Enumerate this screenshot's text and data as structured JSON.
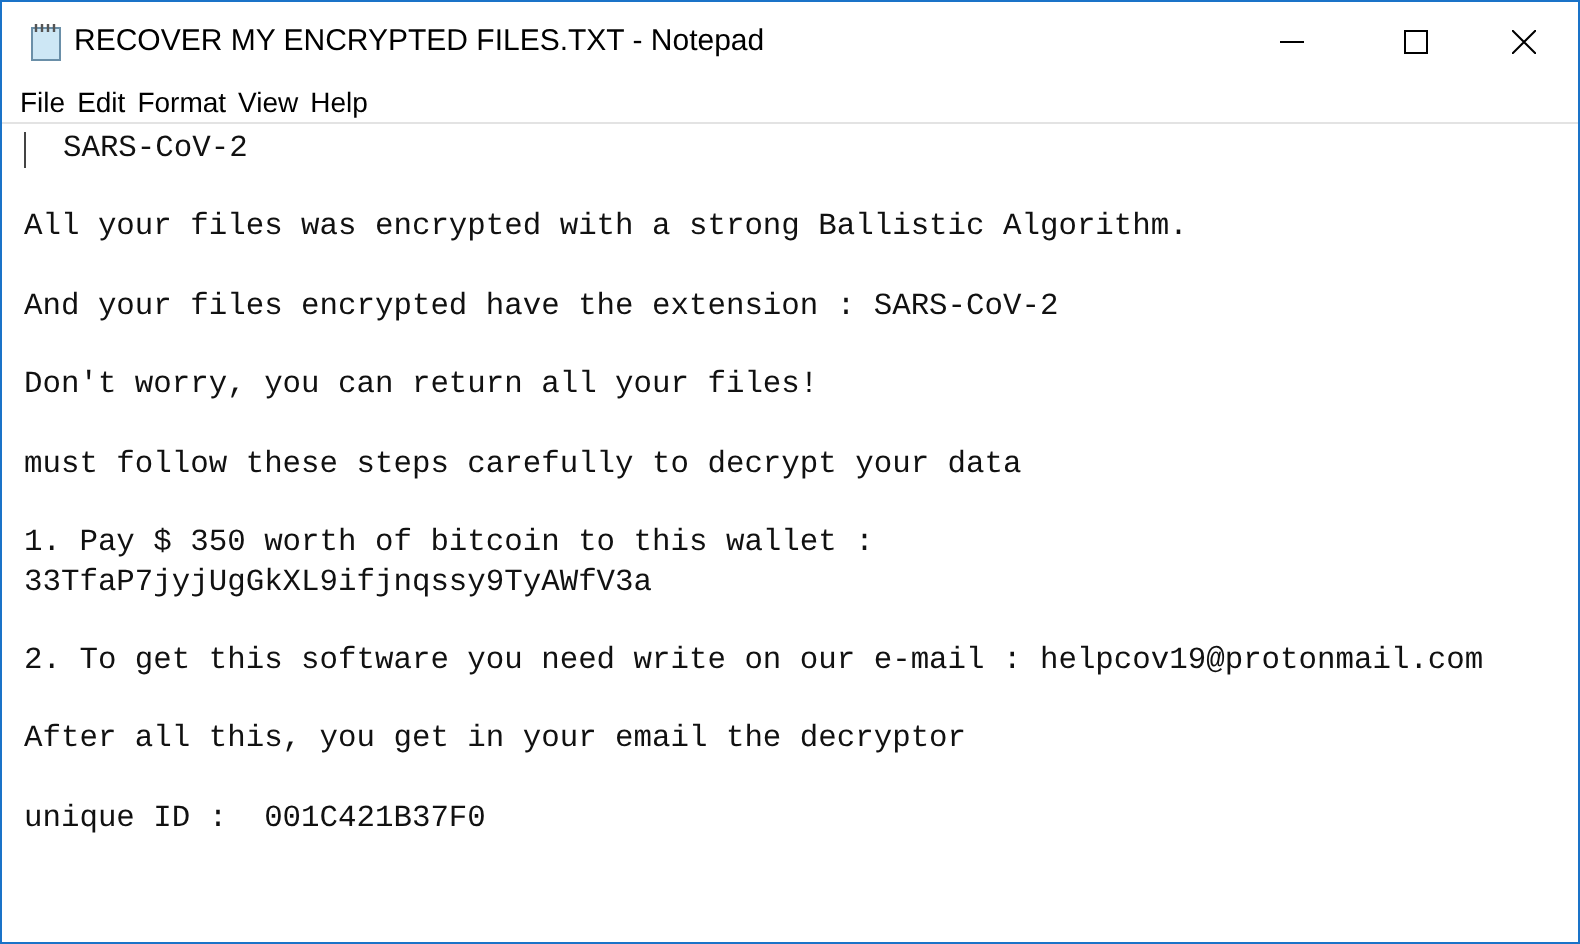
{
  "window": {
    "title": "RECOVER MY ENCRYPTED FILES.TXT - Notepad"
  },
  "menu": [
    "File",
    "Edit",
    "Format",
    "View",
    "Help"
  ],
  "document": {
    "paragraphs": [
      [
        "  SARS-CoV-2"
      ],
      [
        "All your files was encrypted with a strong Ballistic Algorithm."
      ],
      [
        "And your files encrypted have the extension : SARS-CoV-2"
      ],
      [
        "Don't worry, you can return all your files!"
      ],
      [
        "must follow these steps carefully to decrypt your data"
      ],
      [
        "1. Pay $ 350 worth of bitcoin to this wallet :",
        "33TfaP7jyjUgGkXL9ifjnqssy9TyAWfV3a"
      ],
      [
        "2. To get this software you need write on our e-mail : helpcov19@protonmail.com"
      ],
      [
        "After all this, you get in your email the decryptor"
      ],
      [
        "unique ID :  001C421B37F0"
      ]
    ]
  }
}
